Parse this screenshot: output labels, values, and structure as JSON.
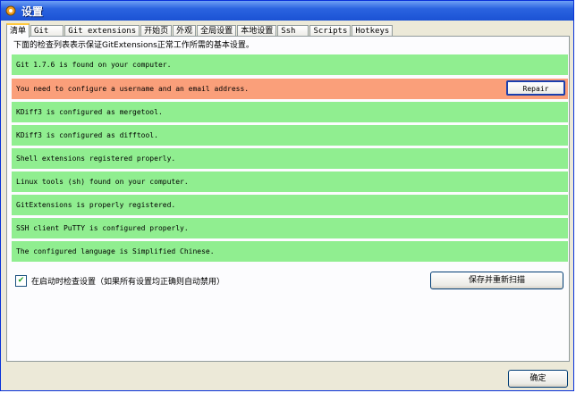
{
  "window": {
    "title": "设置"
  },
  "tabs": [
    {
      "label": "清单",
      "active": true
    },
    {
      "label": "Git"
    },
    {
      "label": "Git extensions"
    },
    {
      "label": "开始页"
    },
    {
      "label": "外观"
    },
    {
      "label": "全局设置"
    },
    {
      "label": "本地设置"
    },
    {
      "label": "Ssh"
    },
    {
      "label": "Scripts"
    },
    {
      "label": "Hotkeys"
    }
  ],
  "checklist": {
    "description": "下面的检查列表表示保证GitExtensions正常工作所需的基本设置。",
    "items": [
      {
        "text": "Git 1.7.6 is found on your computer.",
        "status": "ok"
      },
      {
        "text": "You need to configure a username and an email address.",
        "status": "error",
        "action": "Repair"
      },
      {
        "text": "KDiff3 is configured as mergetool.",
        "status": "ok"
      },
      {
        "text": "KDiff3 is configured as difftool.",
        "status": "ok"
      },
      {
        "text": "Shell extensions registered properly.",
        "status": "ok"
      },
      {
        "text": "Linux tools (sh) found on your computer.",
        "status": "ok"
      },
      {
        "text": "GitExtensions is properly registered.",
        "status": "ok"
      },
      {
        "text": "SSH client PuTTY is configured properly.",
        "status": "ok"
      },
      {
        "text": "The configured language is Simplified Chinese.",
        "status": "ok"
      }
    ],
    "startup_check_label": "在启动时检查设置（如果所有设置均正确则自动禁用）",
    "startup_check_checked": true,
    "rescan_label": "保存并重新扫描"
  },
  "footer": {
    "ok_label": "确定"
  },
  "colors": {
    "ok": "#90ee90",
    "error": "#fa9f7a",
    "title_bar": "#2a63e0"
  }
}
